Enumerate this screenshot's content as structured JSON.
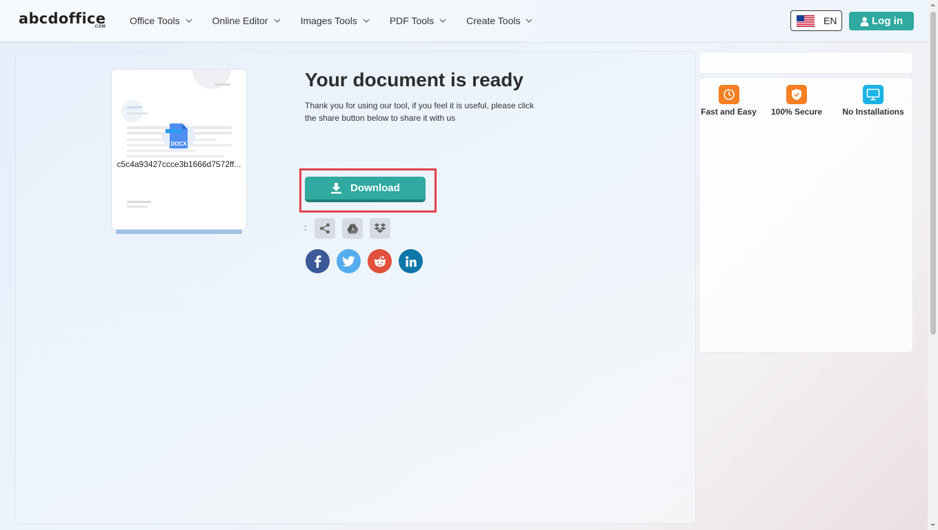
{
  "brand": {
    "name": "abcdoffice",
    "suffix": ".COM"
  },
  "nav": {
    "items": [
      {
        "label": "Office Tools"
      },
      {
        "label": "Online Editor"
      },
      {
        "label": "Images Tools"
      },
      {
        "label": "PDF Tools"
      },
      {
        "label": "Create Tools"
      }
    ]
  },
  "language": {
    "code": "EN",
    "flag": "us-flag-icon"
  },
  "auth": {
    "login_label": "Log in"
  },
  "document": {
    "filename": "c5c4a93427ccce3b1666d7572ff...",
    "file_type": "DOCX"
  },
  "result": {
    "title": "Your document is ready",
    "description": "Thank you for using our tool, if you feel it is useful, please click the share button below to share it with us",
    "download_label": "Download",
    "share_prefix": ":"
  },
  "share_icons": [
    "share-icon",
    "google-drive-icon",
    "dropbox-icon"
  ],
  "social": [
    {
      "name": "facebook-icon",
      "color": "#3b5998"
    },
    {
      "name": "twitter-icon",
      "color": "#55acee"
    },
    {
      "name": "reddit-icon",
      "color": "#e0503c"
    },
    {
      "name": "linkedin-icon",
      "color": "#0e76a8"
    }
  ],
  "features": [
    {
      "label": "Fast and Easy",
      "color": "#f57f22",
      "icon": "clock-icon"
    },
    {
      "label": "100% Secure",
      "color": "#f57f22",
      "icon": "shield-icon"
    },
    {
      "label": "No Installations",
      "color": "#1ab2e8",
      "icon": "monitor-icon"
    }
  ],
  "colors": {
    "accent": "#30aaa0",
    "highlight": "#e0424d"
  }
}
